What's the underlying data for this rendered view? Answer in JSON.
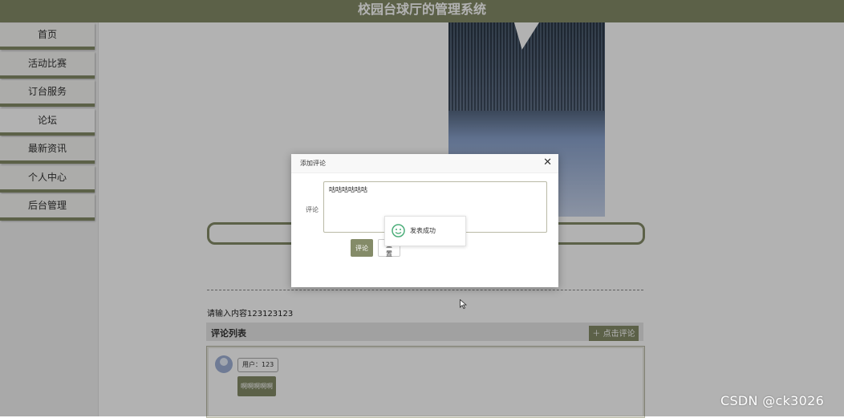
{
  "app": {
    "title": "校园台球厅的管理系统"
  },
  "sidebar": {
    "items": [
      {
        "label": "首页",
        "active": false
      },
      {
        "label": "活动比赛",
        "active": false
      },
      {
        "label": "订台服务",
        "active": false
      },
      {
        "label": "论坛",
        "active": true
      },
      {
        "label": "最新资讯",
        "active": false
      },
      {
        "label": "个人中心",
        "active": false
      },
      {
        "label": "后台管理",
        "active": false
      }
    ]
  },
  "post": {
    "content": "请输入内容123123123"
  },
  "comments": {
    "title": "评论列表",
    "add_label": "点击评论",
    "items": [
      {
        "user": "用户：123",
        "text": "啊啊啊啊啊"
      }
    ]
  },
  "dialog": {
    "title": "添加评论",
    "field_label": "评论",
    "field_value": "咕咕咕咕咕咕",
    "submit_label": "评论",
    "reset_label": "重置"
  },
  "toast": {
    "message": "发表成功"
  },
  "watermark": "CSDN @ck3026",
  "colors": {
    "accent": "#848b68",
    "toast_icon": "#4cae7a"
  }
}
